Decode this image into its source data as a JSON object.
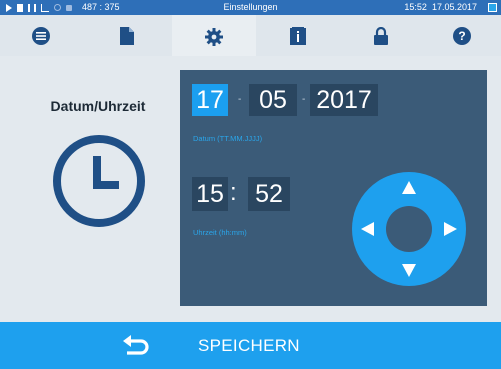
{
  "status_bar": {
    "coords": "487 : 375",
    "title": "Einstellungen",
    "time": "15:52",
    "date": "17.05.2017"
  },
  "tabs": [
    {
      "name": "menu",
      "icon": "list-icon",
      "active": false
    },
    {
      "name": "log",
      "icon": "document-icon",
      "active": false
    },
    {
      "name": "settings",
      "icon": "gear-icon",
      "active": true
    },
    {
      "name": "info",
      "icon": "info-book-icon",
      "active": false
    },
    {
      "name": "lock",
      "icon": "lock-icon",
      "active": false
    },
    {
      "name": "help",
      "icon": "help-icon",
      "active": false
    }
  ],
  "main": {
    "section_title": "Datum/Uhrzeit",
    "date": {
      "day": "17",
      "month": "05",
      "year": "2017",
      "separator": "-",
      "hint": "Datum (TT.MM.JJJJ)"
    },
    "time": {
      "hour": "15",
      "minute": "52",
      "separator": ":",
      "hint": "Uhrzeit (hh:mm)"
    }
  },
  "bottom_bar": {
    "save_label": "SPEICHERN"
  },
  "colors": {
    "accent": "#1ea0ee",
    "status_bar": "#2e6fb8",
    "panel": "#3b5b78",
    "field": "#2a4660",
    "icon_dark": "#1f4f86"
  }
}
